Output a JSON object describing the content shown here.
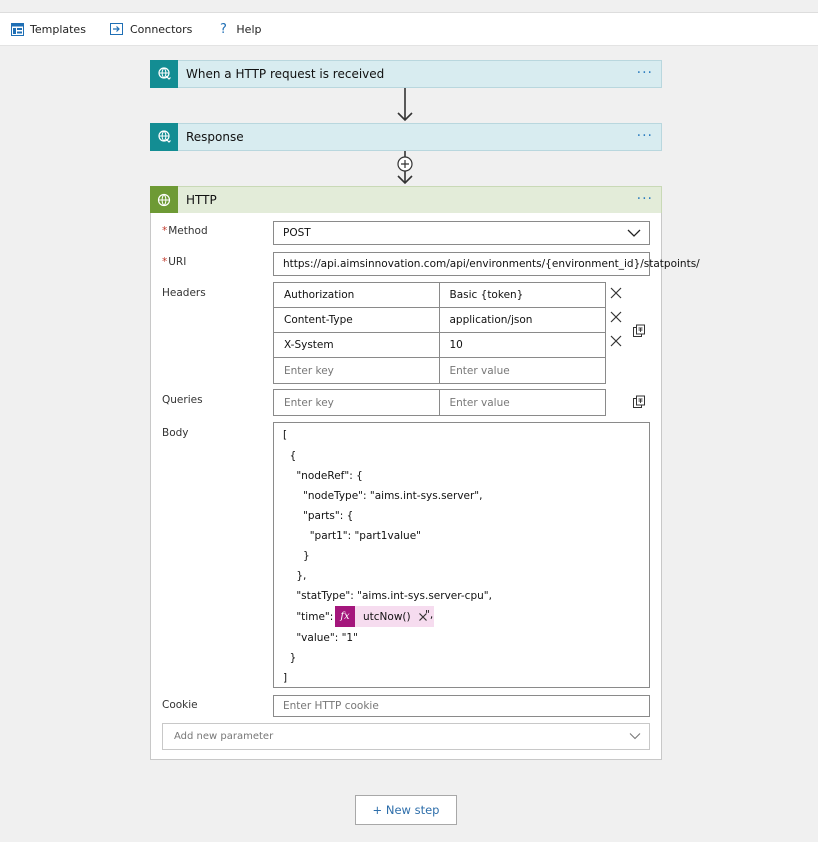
{
  "toolbar": {
    "templates_label": "Templates",
    "connectors_label": "Connectors",
    "help_label": "Help",
    "help_icon": "?"
  },
  "steps": {
    "trigger": {
      "title": "When a HTTP request is received",
      "menu": "···"
    },
    "response": {
      "title": "Response",
      "menu": "···"
    },
    "http": {
      "title": "HTTP",
      "menu": "···"
    }
  },
  "http": {
    "method_label": "Method",
    "method_value": "POST",
    "uri_label": "URI",
    "uri_value": "https://api.aimsinnovation.com/api/environments/{environment_id}/statpoints/",
    "required_mark": "*",
    "headers_label": "Headers",
    "headers": [
      {
        "key": "Authorization",
        "value": "Basic {token}"
      },
      {
        "key": "Content-Type",
        "value": "application/json"
      },
      {
        "key": "X-System",
        "value": "10"
      }
    ],
    "key_placeholder": "Enter key",
    "value_placeholder": "Enter value",
    "queries_label": "Queries",
    "body_label": "Body",
    "body_lines": [
      "[",
      "  {",
      "    \"nodeRef\": {",
      "      \"nodeType\": \"aims.int-sys.server\",",
      "      \"parts\": {",
      "        \"part1\": \"part1value\"",
      "      }",
      "    },",
      "    \"statType\": \"aims.int-sys.server-cpu\",",
      "    \"time\": \"",
      "    \"value\": \"1\"",
      "  }",
      "]"
    ],
    "time_token": {
      "fx": "fx",
      "name": "utcNow()",
      "after": "\","
    },
    "cookie_label": "Cookie",
    "cookie_placeholder": "Enter HTTP cookie",
    "add_param_placeholder": "Add new parameter"
  },
  "new_step_label": "+ New step",
  "colors": {
    "request_header": "#d8ecf0",
    "request_icon": "#138d93",
    "http_header": "#e3ecd9",
    "http_icon": "#6e9a35",
    "expression_token": "#a4167c",
    "link_blue": "#2f6fab"
  }
}
